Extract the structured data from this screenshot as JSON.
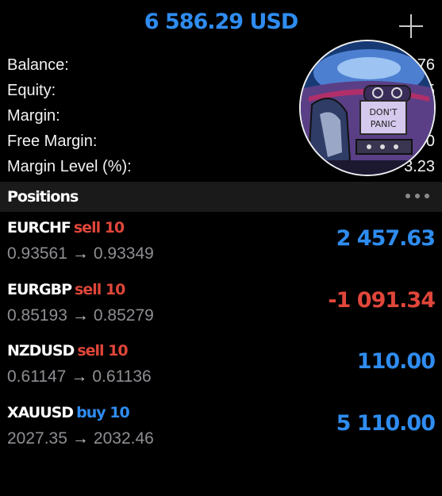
{
  "header": {
    "total_value": "6 586.29 USD",
    "add_icon": "plus-icon"
  },
  "summary": [
    {
      "label": "Balance:",
      "value": "76"
    },
    {
      "label": "Equity:",
      "value": "5"
    },
    {
      "label": "Margin:",
      "value": ""
    },
    {
      "label": "Free Margin:",
      "value": "0"
    },
    {
      "label": "Margin Level (%):",
      "value": "3.23"
    }
  ],
  "avatar": {
    "sign_text": "DON'T PANIC"
  },
  "positions_header": {
    "title": "Positions",
    "menu_icon": "more-dots-icon"
  },
  "positions": [
    {
      "symbol": "EURCHF",
      "side": "sell 10",
      "open": "0.93561",
      "current": "0.93349",
      "profit": "2 457.63"
    },
    {
      "symbol": "EURGBP",
      "side": "sell 10",
      "open": "0.85193",
      "current": "0.85279",
      "profit": "-1 091.34"
    },
    {
      "symbol": "NZDUSD",
      "side": "sell 10",
      "open": "0.61147",
      "current": "0.61136",
      "profit": "110.00"
    },
    {
      "symbol": "XAUUSD",
      "side": "buy 10",
      "open": "2027.35",
      "current": "2032.46",
      "profit": "5 110.00"
    }
  ],
  "arrow_glyph": "→",
  "colors": {
    "accent_blue": "#2f8cf0",
    "loss_red": "#e0463a",
    "background": "#000000",
    "header_band": "#1a1a1a",
    "muted_text": "#8e8e93"
  }
}
